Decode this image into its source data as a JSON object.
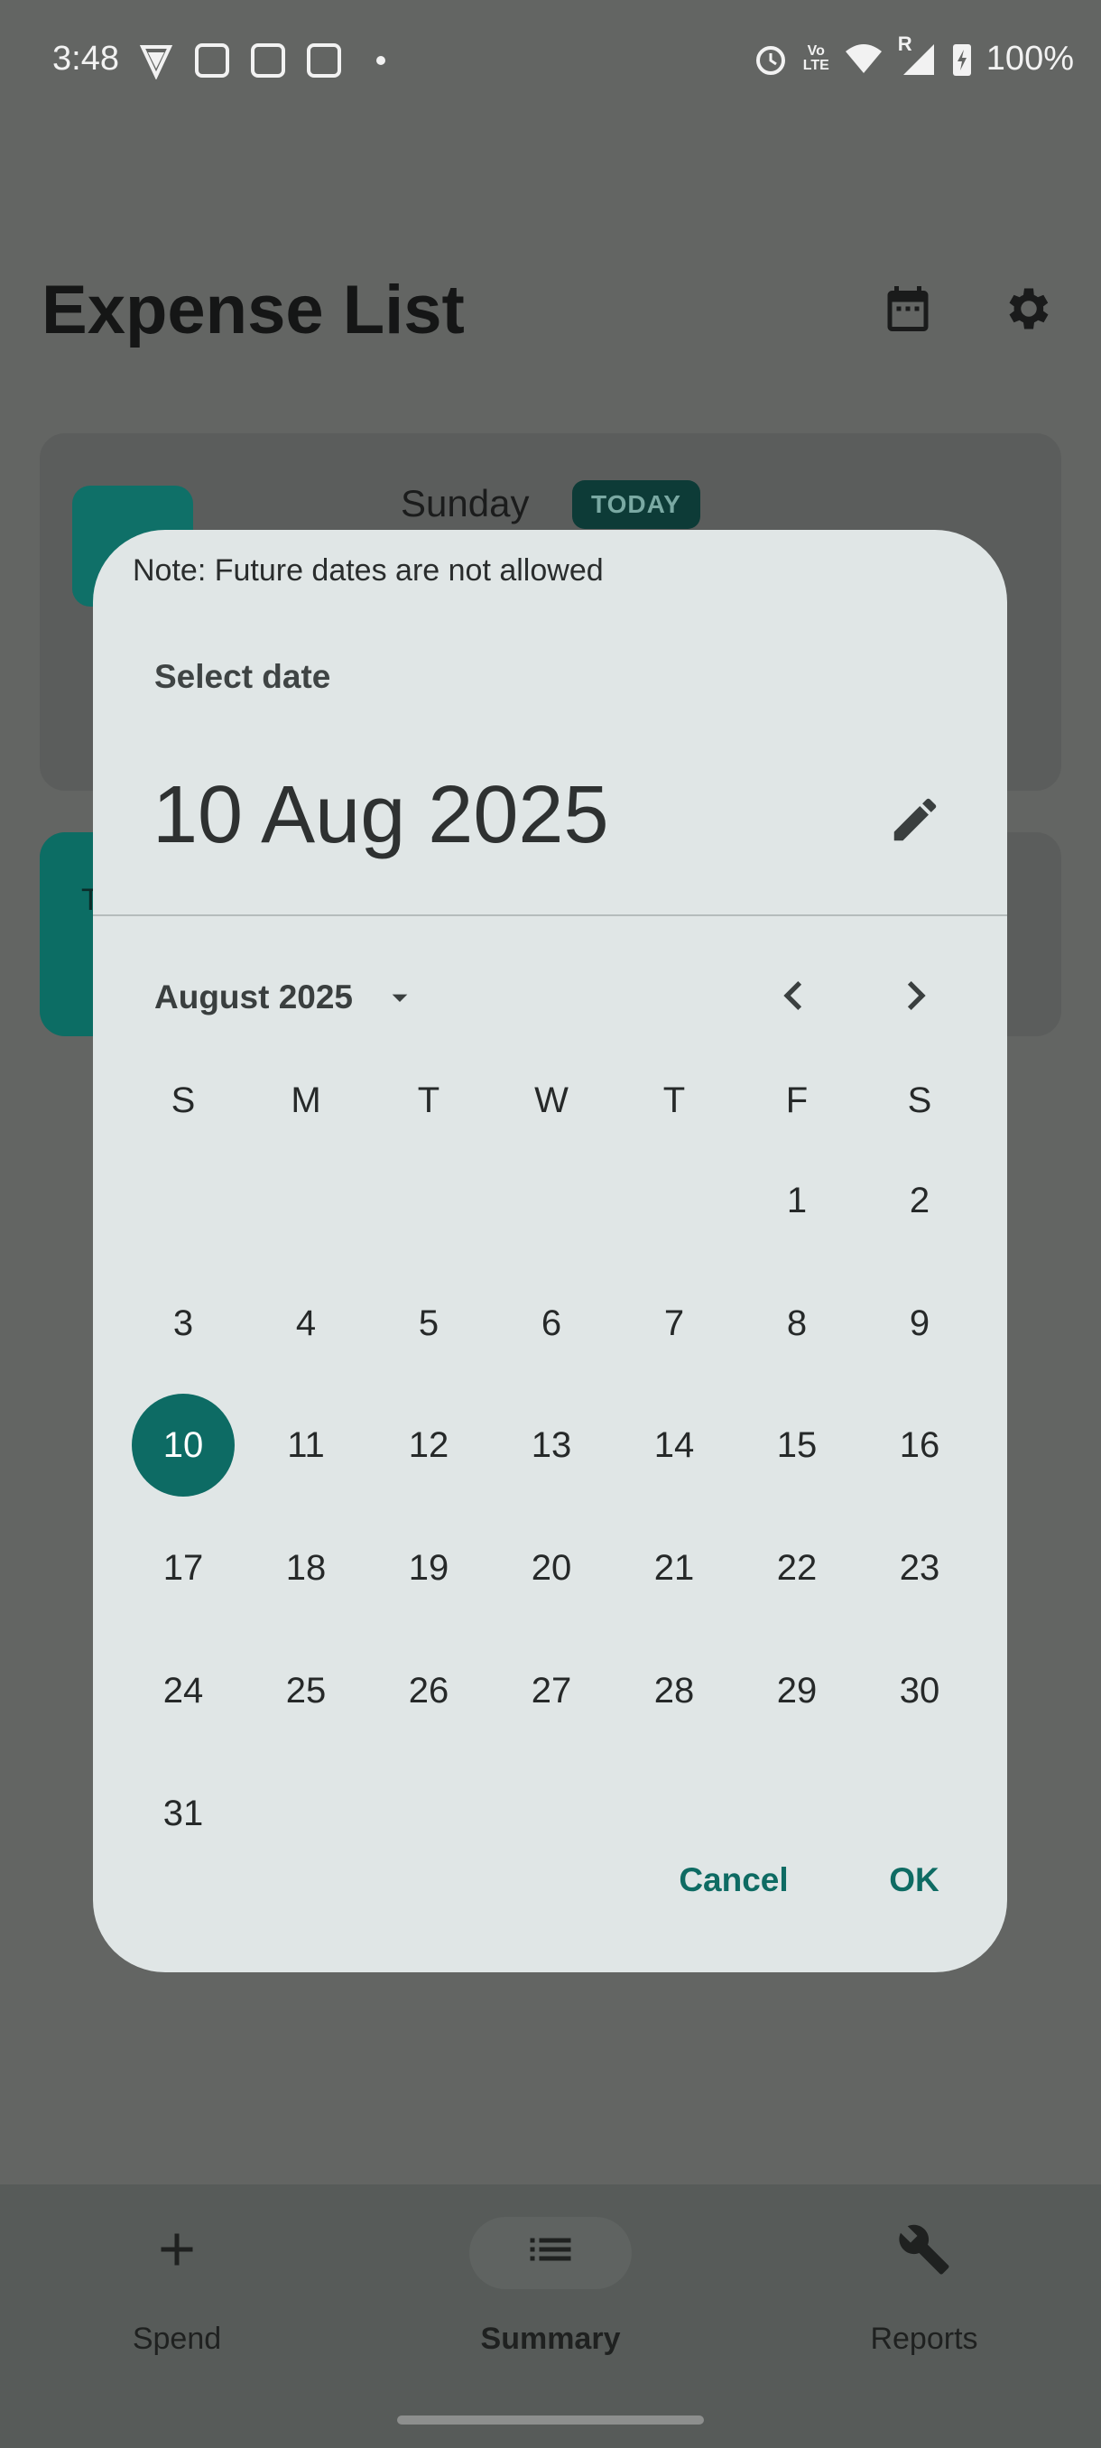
{
  "status_bar": {
    "time": "3:48",
    "battery": "100%",
    "volte": "Vo\nLTE",
    "roaming": "R"
  },
  "app": {
    "title": "Expense List",
    "day_card": {
      "day": "Sunday",
      "badge": "TODAY"
    },
    "summary_card": {
      "initial": "T"
    }
  },
  "bottom_nav": [
    {
      "label": "Spend",
      "icon": "plus-icon"
    },
    {
      "label": "Summary",
      "icon": "list-icon"
    },
    {
      "label": "Reports",
      "icon": "wrench-icon"
    }
  ],
  "dialog": {
    "note": "Note: Future dates are not allowed",
    "header": "Select date",
    "selected_date": "10 Aug 2025",
    "month_label": "August 2025",
    "weekdays": [
      "S",
      "M",
      "T",
      "W",
      "T",
      "F",
      "S"
    ],
    "first_weekday_index": 5,
    "days_in_month": 31,
    "selected_day": 10,
    "cancel_label": "Cancel",
    "ok_label": "OK"
  },
  "colors": {
    "accent": "#0d6b64",
    "scrim": "#636563",
    "dialog_bg": "#e0e6e6"
  }
}
